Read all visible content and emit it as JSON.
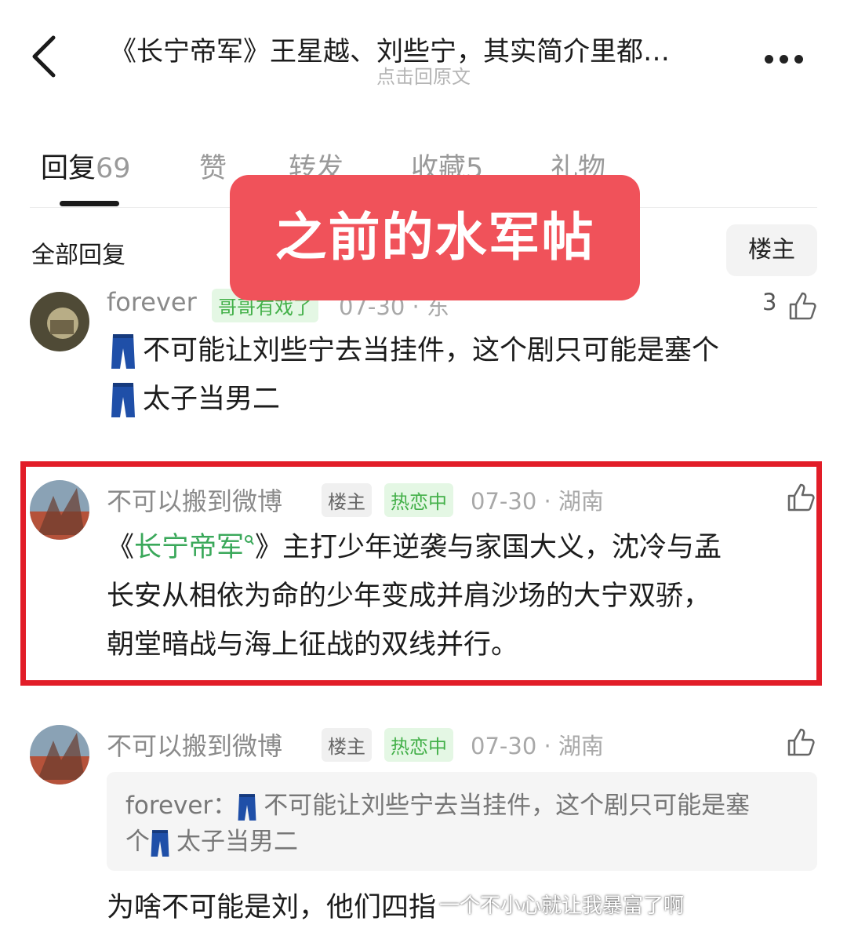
{
  "header": {
    "title": "《长宁帝军》王星越、刘些宁，其实简介里都…",
    "subtitle": "点击回原文"
  },
  "tabs": [
    {
      "label": "回复",
      "count": "69"
    },
    {
      "label": "赞",
      "count": ""
    },
    {
      "label": "转发",
      "count": ""
    },
    {
      "label": "收藏",
      "count": "5"
    },
    {
      "label": "礼物",
      "count": ""
    }
  ],
  "filter": {
    "label": "全部回复",
    "button": "楼主"
  },
  "overlay_banner": "之前的水军帖",
  "comments": [
    {
      "user": "forever",
      "badge": "哥哥有戏了",
      "meta": "07-30 · 东",
      "likes": "3",
      "line1": "不可能让刘些宁去当挂件，这个剧只可能是塞个",
      "line2": "太子当男二"
    },
    {
      "user": "不可以搬到微博",
      "tag_owner": "楼主",
      "tag_status": "热恋中",
      "meta": "07-30 · 湖南",
      "text_open": "《",
      "link": "长宁帝军",
      "text_close": "》主打少年逆袭与家国大义，沈冷与孟",
      "line2": "长安从相依为命的少年变成并肩沙场的大宁双骄，",
      "line3": "朝堂暗战与海上征战的双线并行。"
    },
    {
      "user": "不可以搬到微博",
      "tag_owner": "楼主",
      "tag_status": "热恋中",
      "meta": "07-30 · 湖南",
      "quote_user": "forever：",
      "quote_line1": "不可能让刘些宁去当挂件，这个剧只可能是塞",
      "quote_line2_a": "个",
      "quote_line2_b": "太子当男二",
      "reply": "为啥不可能是刘，他们四指"
    }
  ],
  "watermark": "一个不小心就让我暴富了啊",
  "colors": {
    "banner": "#f0525a",
    "highlight_border": "#e21d28",
    "link": "#3aa85a",
    "tag_green": "#43b049"
  }
}
